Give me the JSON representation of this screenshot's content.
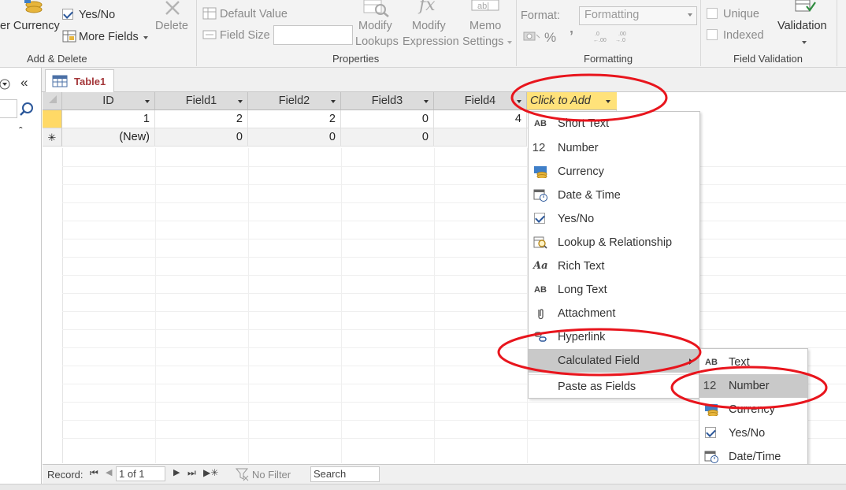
{
  "ribbon": {
    "groups": {
      "add_delete": "Add & Delete",
      "properties": "Properties",
      "formatting": "Formatting",
      "field_validation": "Field Validation"
    },
    "currency_label": "er Currency",
    "yes_no_label": "Yes/No",
    "more_fields_label": "More Fields",
    "delete_label": "Delete",
    "default_value_label": "Default Value",
    "field_size_label": "Field Size",
    "modify_lookups_label_1": "Modify",
    "modify_lookups_label_2": "Lookups",
    "modify_expression_label_1": "Modify",
    "modify_expression_label_2": "Expression",
    "memo_settings_label_1": "Memo",
    "memo_settings_label_2": "Settings",
    "format_label": "Format:",
    "format_placeholder": "Formatting",
    "percent_glyph": "%",
    "comma_glyph": "’",
    "unique_label": "Unique",
    "indexed_label": "Indexed",
    "validation_label": "Validation"
  },
  "tab": {
    "label": "Table1"
  },
  "grid": {
    "headers": [
      "ID",
      "Field1",
      "Field2",
      "Field3",
      "Field4"
    ],
    "click_to_add": "Click to Add",
    "rows": [
      [
        "1",
        "2",
        "2",
        "0",
        "4"
      ],
      [
        "(New)",
        "0",
        "0",
        "0",
        ""
      ]
    ],
    "new_row_glyph": "✳"
  },
  "menu": {
    "items": [
      {
        "icon": "AB",
        "label": "Short Text"
      },
      {
        "icon": "12",
        "label": "Number"
      },
      {
        "icon": "",
        "label": "Currency"
      },
      {
        "icon": "",
        "label": "Date & Time"
      },
      {
        "icon": "",
        "label": "Yes/No"
      },
      {
        "icon": "",
        "label": "Lookup & Relationship"
      },
      {
        "icon": "Aa",
        "label": "Rich Text"
      },
      {
        "icon": "AB",
        "label": "Long Text"
      },
      {
        "icon": "",
        "label": "Attachment"
      },
      {
        "icon": "",
        "label": "Hyperlink"
      },
      {
        "icon": "",
        "label": "Calculated Field"
      },
      {
        "icon": "",
        "label": "Paste as Fields"
      }
    ]
  },
  "submenu": {
    "items": [
      {
        "icon": "AB",
        "label": "Text"
      },
      {
        "icon": "12",
        "label": "Number"
      },
      {
        "icon": "",
        "label": "Currency"
      },
      {
        "icon": "",
        "label": "Yes/No"
      },
      {
        "icon": "",
        "label": "Date/Time"
      }
    ]
  },
  "status": {
    "record_label": "Record:",
    "record_value": "1 of 1",
    "no_filter_label": "No Filter",
    "search_placeholder": "Search"
  },
  "colors": {
    "annotation": "#e8151d",
    "click_to_add_bg": "#ffe27a",
    "tab_text": "#a4373a",
    "menu_highlight": "#c9c9c9"
  }
}
